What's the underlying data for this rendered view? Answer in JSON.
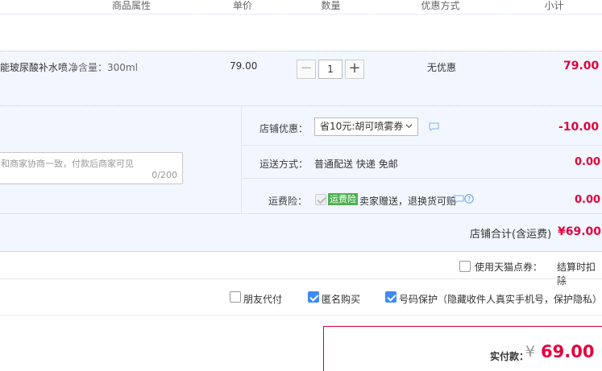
{
  "header": {
    "col_attrs": "商品属性",
    "col_price": "单价",
    "col_qty": "数量",
    "col_discount": "优惠方式",
    "col_subtotal": "小计"
  },
  "item": {
    "name": "能玻尿酸补水喷…",
    "spec": "净含量：300ml",
    "price": "79.00",
    "qty_minus": "−",
    "qty_value": "1",
    "qty_plus": "+",
    "discount": "无优惠",
    "subtotal": "79.00"
  },
  "shop": {
    "coupon_label": "店铺优惠：",
    "coupon_select": "省10元:胡可喷雾券",
    "coupon_amount": "-10.00",
    "message_placeholder": "和商家协商一致，付款后商家可见",
    "message_count": "0/200",
    "delivery_label": "运送方式：",
    "delivery_value": "普通配送 快递 免邮",
    "delivery_amount": "0.00",
    "insurance_label": "运费险：",
    "insurance_tag": "运费险",
    "insurance_text": "卖家赠送，退换货可赔",
    "insurance_amount": "0.00",
    "total_label": "店铺合计(含运费)",
    "total_value": "¥69.00"
  },
  "points": {
    "label": "使用天猫点券：",
    "note": "结算时扣除"
  },
  "options": {
    "friend_pay": "朋友代付",
    "anonymous": "匿名购买",
    "privacy": "号码保护（隐藏收件人真实手机号，保护隐私）"
  },
  "pay": {
    "label": "实付款：",
    "currency": "¥",
    "amount": "69.00"
  },
  "colors": {
    "accent_red": "#e4003a",
    "row_bg": "#f2f7ff",
    "checkbox_blue": "#3d8af7",
    "tag_green": "#4caf50"
  }
}
